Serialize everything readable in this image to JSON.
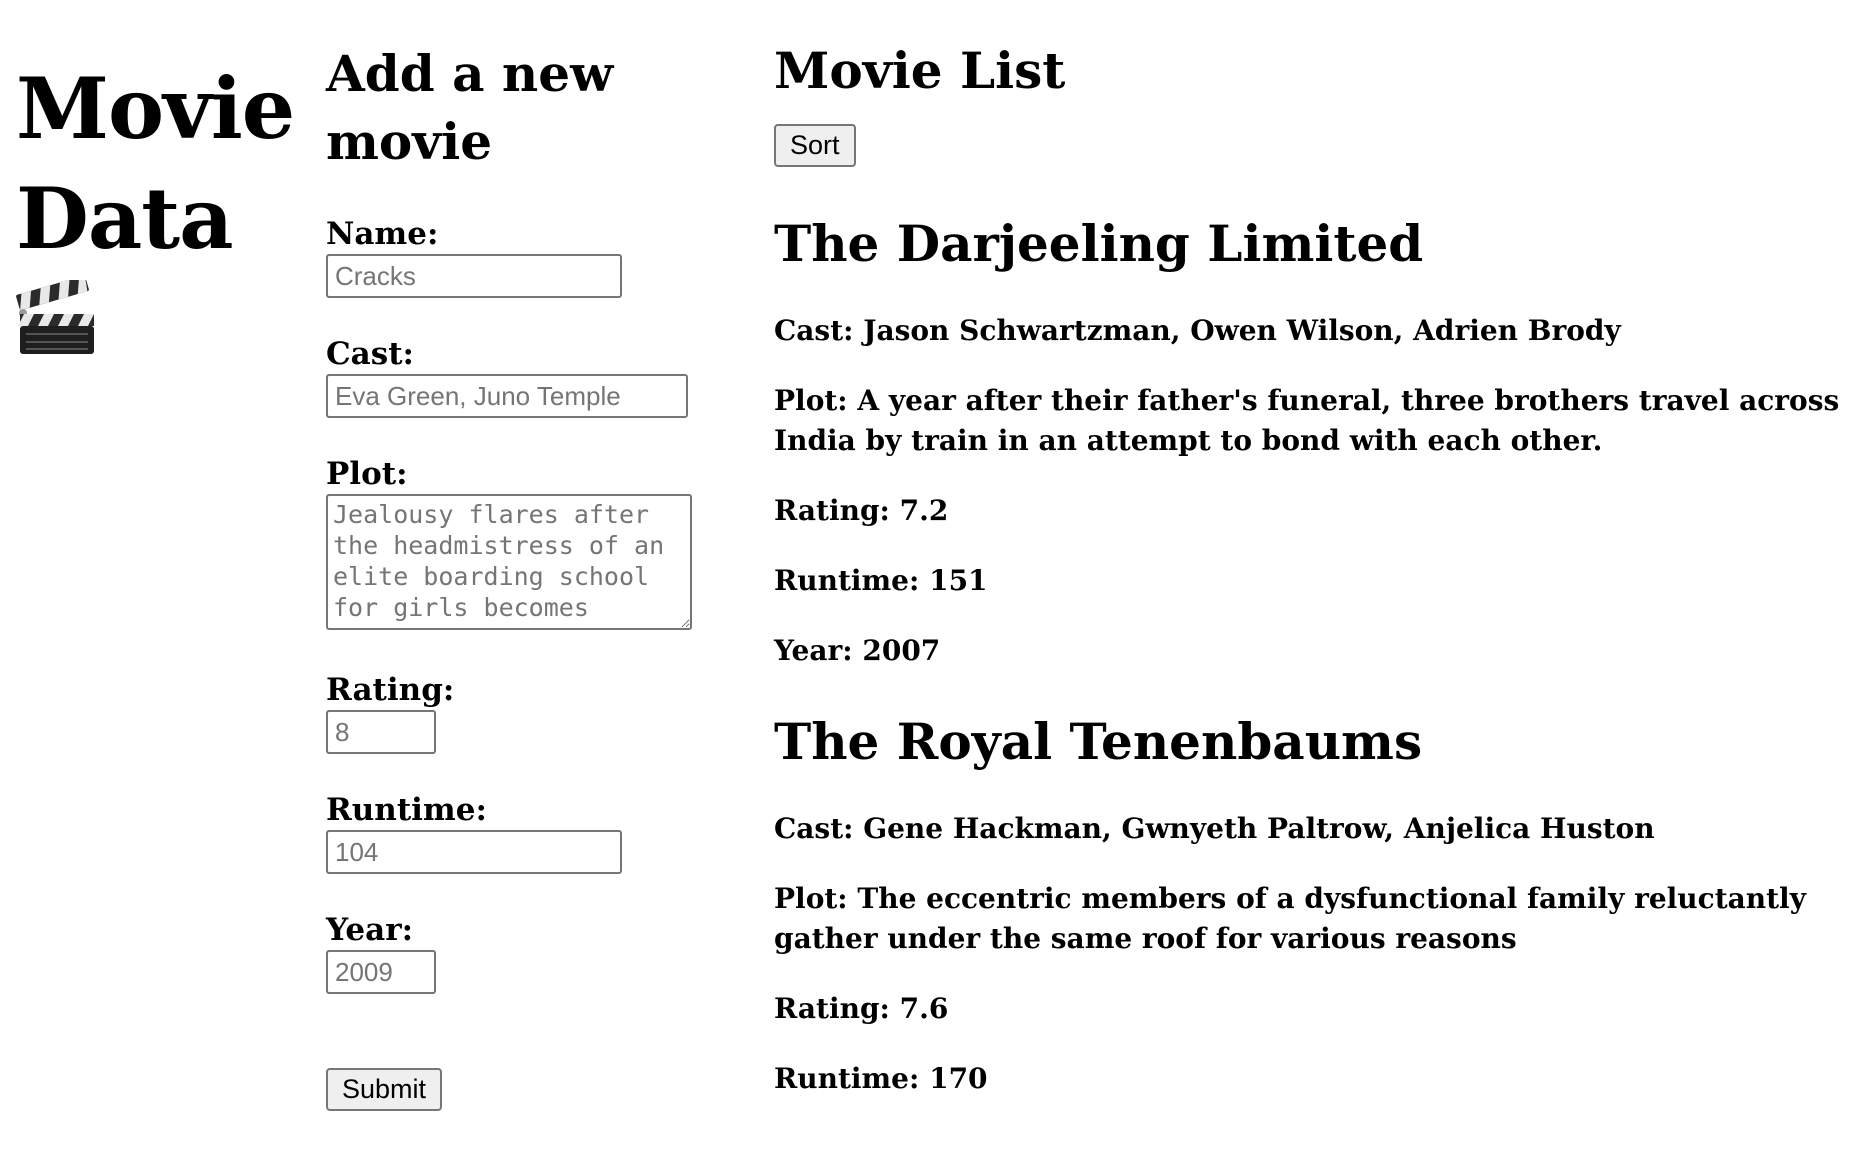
{
  "brand": {
    "title_line1": "Movie",
    "title_line2": "Data",
    "icon": "clapperboard-icon"
  },
  "form": {
    "heading": "Add a new movie",
    "fields": {
      "name": {
        "label": "Name:",
        "placeholder": "Cracks"
      },
      "cast": {
        "label": "Cast:",
        "placeholder": "Eva Green, Juno Temple"
      },
      "plot": {
        "label": "Plot:",
        "placeholder": "Jealousy flares after the headmistress of an elite boarding school for girls becomes"
      },
      "rating": {
        "label": "Rating:",
        "placeholder": "8"
      },
      "runtime": {
        "label": "Runtime:",
        "placeholder": "104"
      },
      "year": {
        "label": "Year:",
        "placeholder": "2009"
      }
    },
    "submit_label": "Submit"
  },
  "list": {
    "heading": "Movie List",
    "sort_label": "Sort",
    "movies": [
      {
        "title": "The Darjeeling Limited",
        "cast": "Cast: Jason Schwartzman, Owen Wilson, Adrien Brody",
        "plot": "Plot: A year after their father's funeral, three brothers travel across India by train in an attempt to bond with each other.",
        "rating": "Rating: 7.2",
        "runtime": "Runtime: 151",
        "year": "Year: 2007"
      },
      {
        "title": "The Royal Tenenbaums",
        "cast": "Cast: Gene Hackman, Gwnyeth Paltrow, Anjelica Huston",
        "plot": "Plot: The eccentric members of a dysfunctional family reluctantly gather under the same roof for various reasons",
        "rating": "Rating: 7.6",
        "runtime": "Runtime: 170"
      }
    ]
  }
}
